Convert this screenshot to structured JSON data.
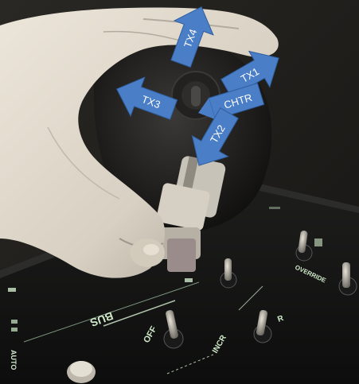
{
  "photo": {
    "subject": "hand gripping aircraft control stick over lit switch panel",
    "arrow_color": "#4a7ec7"
  },
  "arrows": [
    {
      "label": "TX4"
    },
    {
      "label": "TX1"
    },
    {
      "label": "TX3"
    },
    {
      "label": "CHTR"
    },
    {
      "label": "TX2"
    }
  ],
  "panel_labels": {
    "bus": "BUS",
    "off": "OFF",
    "incr": "INCR",
    "override": "OVERRIDE",
    "auto": "AUTO",
    "r": "R"
  }
}
